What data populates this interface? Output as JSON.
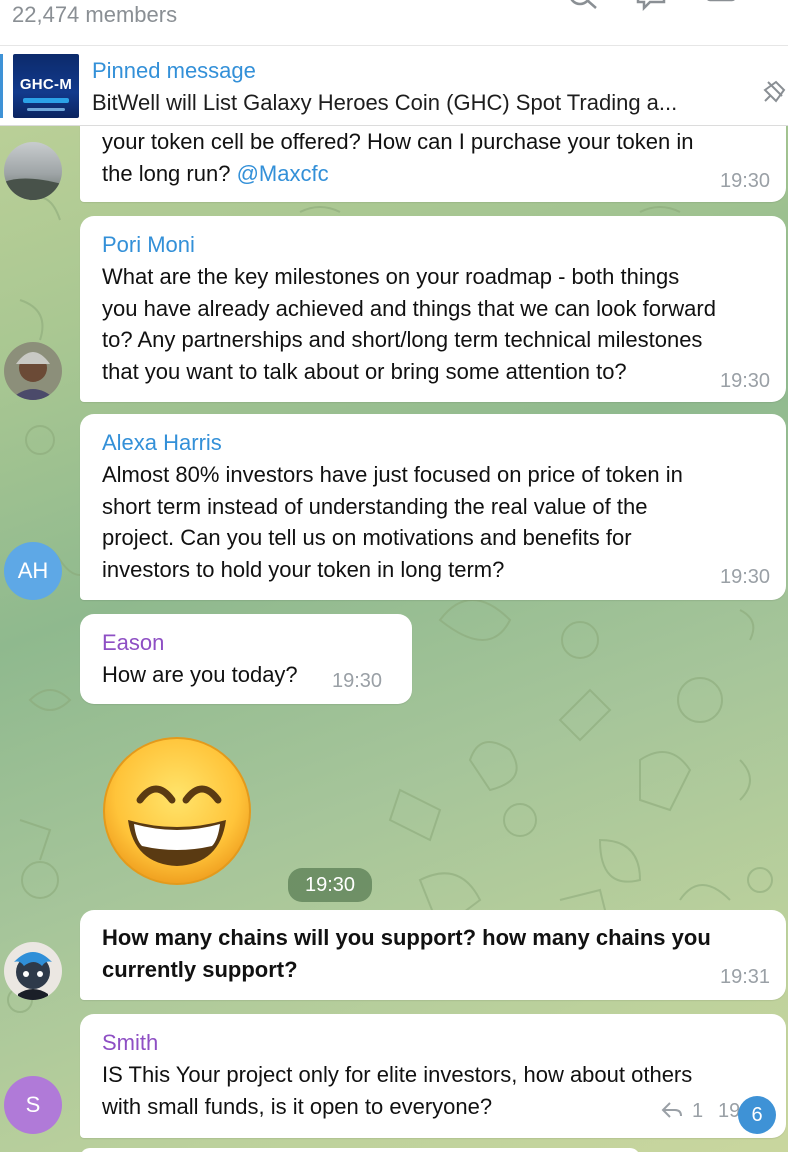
{
  "header": {
    "members": "22,474 members",
    "icons": [
      "search-icon",
      "voice-chat-icon",
      "sidebar-icon",
      "more-icon"
    ]
  },
  "pinned": {
    "title": "Pinned message",
    "thumb_text": "GHC-M",
    "text": "BitWell will List Galaxy Heroes Coin (GHC) Spot Trading a...",
    "icon": "pin-icon"
  },
  "messages": [
    {
      "sender": "",
      "lines": [
        "your token cell be offered? How can I purchase your token in",
        "the long run?"
      ],
      "mention": "@Maxcfc",
      "time": "19:30"
    },
    {
      "sender": "Pori Moni",
      "sender_color": "#3390d8",
      "lines": [
        "What are the key milestones on your roadmap - both things",
        "you have already achieved and things that we can look forward",
        "to?  Any partnerships and short/long term technical milestones",
        "that you want to talk about or bring some attention to?"
      ],
      "time": "19:30"
    },
    {
      "sender": "Alexa Harris",
      "sender_color": "#3390d8",
      "avatar_initials": "AH",
      "avatar_color": "#5ea8e6",
      "lines": [
        "Almost 80% investors have just focused on price of token in",
        "short term instead of understanding the real value of the",
        "project. Can you tell us on motivations and benefits for",
        "investors to hold your token in long term?"
      ],
      "time": "19:30"
    },
    {
      "sender": "Eason",
      "sender_color": "#8e4fc4",
      "lines": [
        "How are you today?"
      ],
      "time": "19:30"
    },
    {
      "sticker": "grinning-emoji-sticker",
      "time": "19:30"
    },
    {
      "sender": "",
      "lines": [
        "How many chains will you support? how many chains you",
        "currently support?"
      ],
      "time": "19:31"
    },
    {
      "sender": "Smith",
      "sender_color": "#8e4fc4",
      "avatar_initials": "S",
      "avatar_color": "#b07ad8",
      "lines": [
        "IS This Your project only for elite investors, how about others",
        "with small funds, is it open to everyone?"
      ],
      "replies": "1",
      "time": "19"
    }
  ],
  "unread_badge": "6",
  "colors": {
    "accent": "#3390d8",
    "time": "#9aa0a6"
  }
}
